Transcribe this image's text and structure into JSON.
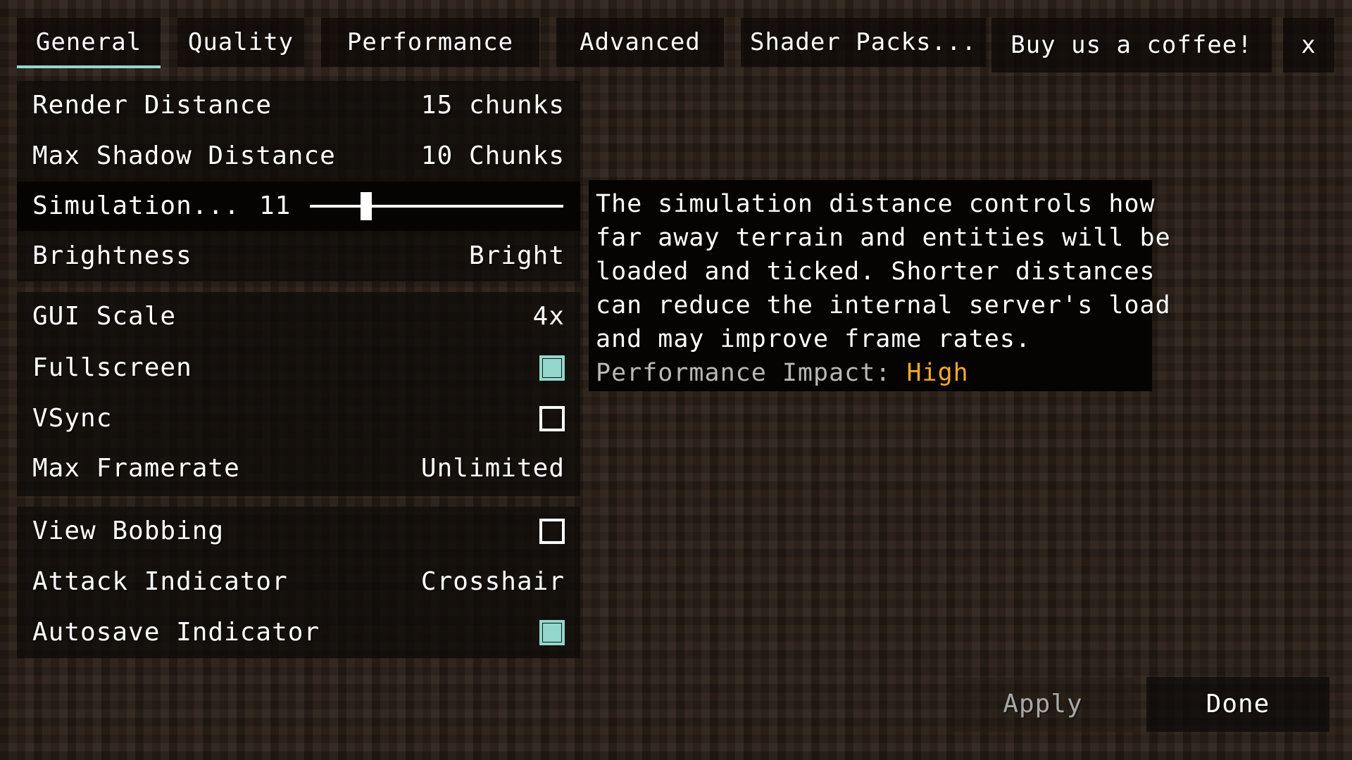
{
  "tabs": [
    {
      "label": "General",
      "active": true
    },
    {
      "label": "Quality",
      "active": false
    },
    {
      "label": "Performance",
      "active": false
    },
    {
      "label": "Advanced",
      "active": false
    },
    {
      "label": "Shader Packs...",
      "active": false
    }
  ],
  "coffee_button": "Buy us a coffee!",
  "close_button": "x",
  "groups": [
    {
      "rows": [
        {
          "label": "Render Distance",
          "type": "value",
          "value": "15 chunks"
        },
        {
          "label": "Max Shadow Distance",
          "type": "value",
          "value": "10 Chunks"
        },
        {
          "label": "Simulation...",
          "type": "slider",
          "value": "11",
          "min": 5,
          "max": 32,
          "current": 11,
          "highlighted": true
        },
        {
          "label": "Brightness",
          "type": "value",
          "value": "Bright"
        }
      ]
    },
    {
      "rows": [
        {
          "label": "GUI Scale",
          "type": "value",
          "value": "4x"
        },
        {
          "label": "Fullscreen",
          "type": "checkbox",
          "checked": true
        },
        {
          "label": "VSync",
          "type": "checkbox",
          "checked": false
        },
        {
          "label": "Max Framerate",
          "type": "value",
          "value": "Unlimited"
        }
      ]
    },
    {
      "rows": [
        {
          "label": "View Bobbing",
          "type": "checkbox",
          "checked": false
        },
        {
          "label": "Attack Indicator",
          "type": "value",
          "value": "Crosshair"
        },
        {
          "label": "Autosave Indicator",
          "type": "checkbox",
          "checked": true
        }
      ]
    }
  ],
  "tooltip": {
    "lines": [
      "The simulation distance controls how",
      "far away terrain and entities will be",
      "loaded and ticked. Shorter distances",
      "can reduce the internal server's load",
      "and may improve frame rates."
    ],
    "impact_label": "Performance Impact: ",
    "impact_value": "High"
  },
  "buttons": {
    "apply": "Apply",
    "done": "Done"
  },
  "colors": {
    "accent": "#93d8cc",
    "impact_high": "#f5a82a",
    "disabled_text": "#a8a8a8"
  }
}
